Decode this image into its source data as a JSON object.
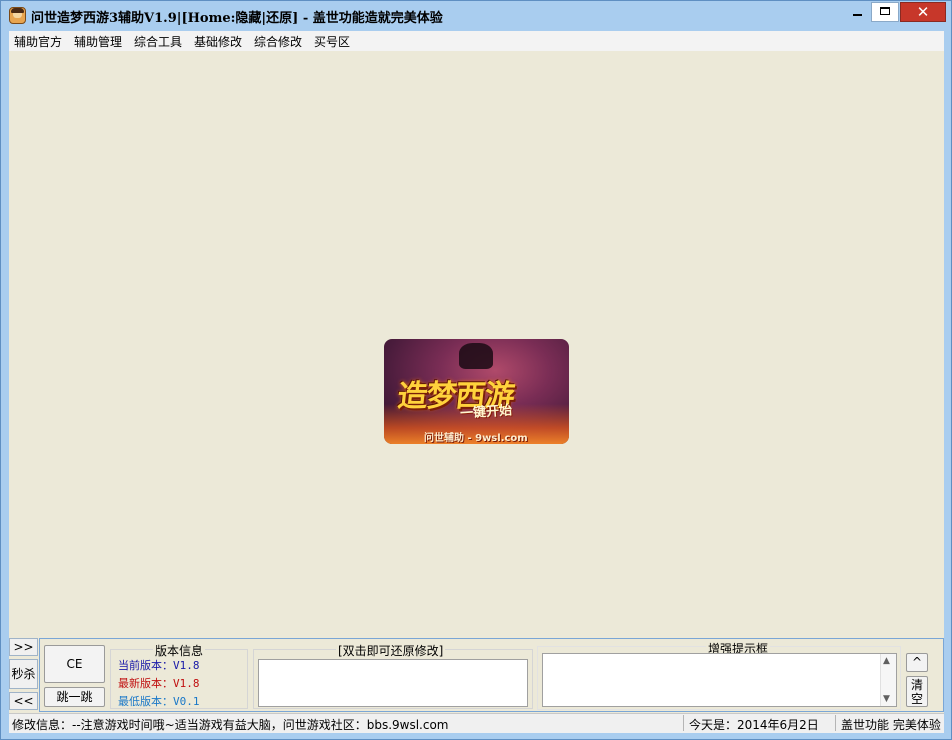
{
  "window": {
    "title": "问世造梦西游3辅助V1.9|[Home:隐藏|还原] - 盖世功能造就完美体验",
    "close_glyph": "✕"
  },
  "menu": {
    "items": [
      "辅助官方",
      "辅助管理",
      "综合工具",
      "基础修改",
      "综合修改",
      "买号区"
    ]
  },
  "banner": {
    "title": "造梦西游",
    "subtitle": "一键开始",
    "site": "问世辅助 - 9wsl.com"
  },
  "side": {
    "expand": ">>",
    "kill": "秒杀",
    "collapse": "<<"
  },
  "buttons": {
    "ce": "CE",
    "jump": "跳一跳"
  },
  "version": {
    "group_title": "版本信息",
    "current_label": "当前版本：",
    "current_value": "V1.8",
    "latest_label": "最新版本：",
    "latest_value": "V1.8",
    "min_label": "最低版本：",
    "min_value": "V0.1",
    "colors": {
      "current": "#1a1aa8",
      "latest": "#c01010",
      "min": "#1a78c8"
    }
  },
  "restore": {
    "group_title": "[双击即可还原修改]"
  },
  "hint": {
    "group_title": "增强提示框",
    "scroll_up": "^",
    "clear": "清空",
    "up_glyph": "▲",
    "down_glyph": "▼"
  },
  "status": {
    "modify_info": "修改信息：--注意游戏时间哦~适当游戏有益大脑，问世游戏社区：bbs.9wsl.com",
    "today": "今天是：2014年6月2日",
    "slogan": "盖世功能 完美体验"
  }
}
